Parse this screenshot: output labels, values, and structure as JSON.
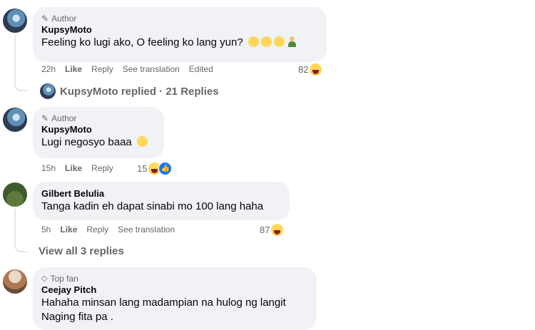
{
  "comments": [
    {
      "author": "KupsyMoto",
      "badge": "Author",
      "text": "Feeling ko lugi ako, O feeling ko lang yun?",
      "time": "22h",
      "like": "Like",
      "reply": "Reply",
      "translate": "See translation",
      "edited": "Edited",
      "reactions": "82",
      "reply_summary": "KupsyMoto replied · 21 Replies"
    },
    {
      "author": "KupsyMoto",
      "badge": "Author",
      "text": "Lugi negosyo baaa",
      "time": "15h",
      "like": "Like",
      "reply": "Reply",
      "reactions": "15"
    },
    {
      "author": "Gilbert Belulia",
      "text": "Tanga kadin eh dapat sinabi mo 100 lang haha",
      "time": "5h",
      "like": "Like",
      "reply": "Reply",
      "translate": "See translation",
      "reactions": "87",
      "view_replies": "View all 3 replies"
    },
    {
      "author": "Ceejay Pitch",
      "badge": "Top fan",
      "text_line1": "Hahaha minsan lang madampian na hulog ng langit",
      "text_line2": "Naging fita pa ."
    }
  ],
  "icons": {
    "author_badge": "pencil-icon",
    "topfan_badge": "diamond-icon",
    "reaction_haha": "haha-reaction-icon",
    "reaction_like": "like-reaction-icon"
  },
  "colors": {
    "bubble": "#f0f2f5",
    "secondary_text": "#65676b",
    "like_blue": "#1877f2"
  }
}
